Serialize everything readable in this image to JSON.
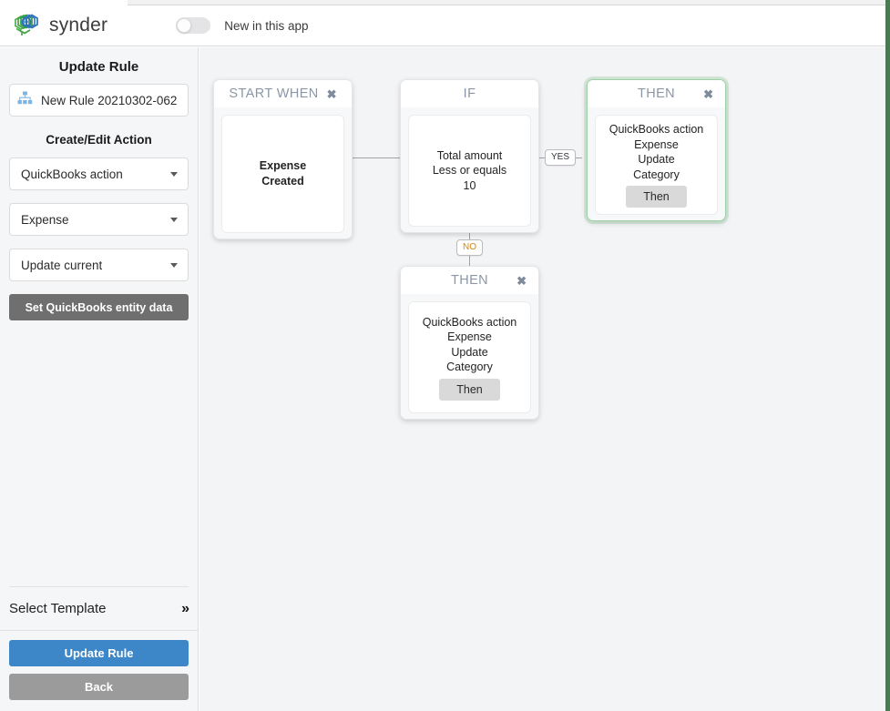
{
  "header": {
    "brand_name": "synder",
    "logo_icon": "synder-hex-logo",
    "toggle_state": "off",
    "toggle_label": "New in this app"
  },
  "sidebar": {
    "panel_title": "Update Rule",
    "rule_name_icon": "sitemap-icon",
    "rule_name_value": "New Rule 20210302-062",
    "section_title": "Create/Edit Action",
    "selects": [
      {
        "name": "action-type",
        "value": "QuickBooks action"
      },
      {
        "name": "entity-type",
        "value": "Expense"
      },
      {
        "name": "operation-type",
        "value": "Update current"
      }
    ],
    "entity_data_button": "Set QuickBooks entity data",
    "template_label": "Select Template",
    "template_icon": "double-chevron-right-icon",
    "update_button": "Update Rule",
    "back_button": "Back"
  },
  "canvas": {
    "connectors": {
      "yes_label": "YES",
      "no_label": "NO",
      "yes_color": "#33383d",
      "no_color": "#d58512"
    },
    "nodes": [
      {
        "id": "start-when",
        "title": "START WHEN",
        "close_icon": "close-icon",
        "has_close": true,
        "selected": false,
        "lines": [
          "Expense",
          "Created"
        ],
        "bold": true,
        "pill": null
      },
      {
        "id": "if",
        "title": "IF",
        "close_icon": null,
        "has_close": false,
        "selected": false,
        "lines": [
          "Total amount",
          "Less or equals",
          "10"
        ],
        "bold": false,
        "pill": null
      },
      {
        "id": "then-yes",
        "title": "THEN",
        "close_icon": "close-icon",
        "has_close": true,
        "selected": true,
        "lines": [
          "QuickBooks action",
          "Expense",
          "Update",
          "Category"
        ],
        "bold": false,
        "pill": "Then"
      },
      {
        "id": "then-no",
        "title": "THEN",
        "close_icon": "close-icon",
        "has_close": true,
        "selected": false,
        "lines": [
          "QuickBooks action",
          "Expense",
          "Update",
          "Category"
        ],
        "bold": false,
        "pill": "Then"
      }
    ]
  },
  "colors": {
    "accent_blue": "#3d87c8",
    "selected_green": "#9dd2a6",
    "gray_button": "#6f6f6f",
    "back_gray": "#9b9b9b",
    "node_title": "#8b97a6",
    "canvas_bg": "#f3f4f6",
    "sidebar_bg": "#f5f6f7",
    "right_edge": "#4a7a53"
  }
}
